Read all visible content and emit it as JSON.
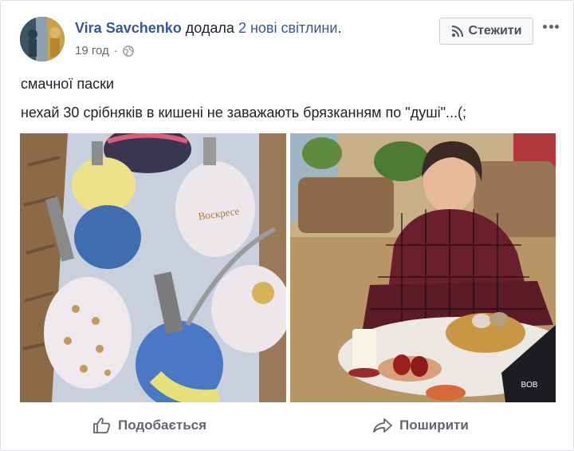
{
  "post": {
    "author": "Vira Savchenko",
    "action_prefix": "додала",
    "action_link": "2 нові світлини",
    "action_suffix": ".",
    "time": "19 год",
    "separator": "·",
    "follow_label": "Стежити",
    "text_line1": "смачної паски",
    "text_line2": "нехай 30 срібняків в кишені не заважають брязканням по \"душі\"...(;",
    "photo1_caption": "Воскресе",
    "photo2_caption": "BOB"
  },
  "actions": {
    "like_label": "Подобається",
    "share_label": "Поширити"
  },
  "icons": {
    "privacy": "globe-icon",
    "follow": "rss-icon",
    "more": "more-icon",
    "like": "thumbs-up-icon",
    "share": "share-arrow-icon"
  },
  "colors": {
    "link": "#365899",
    "text": "#1d2129",
    "muted": "#616770",
    "border": "#dddfe2"
  }
}
